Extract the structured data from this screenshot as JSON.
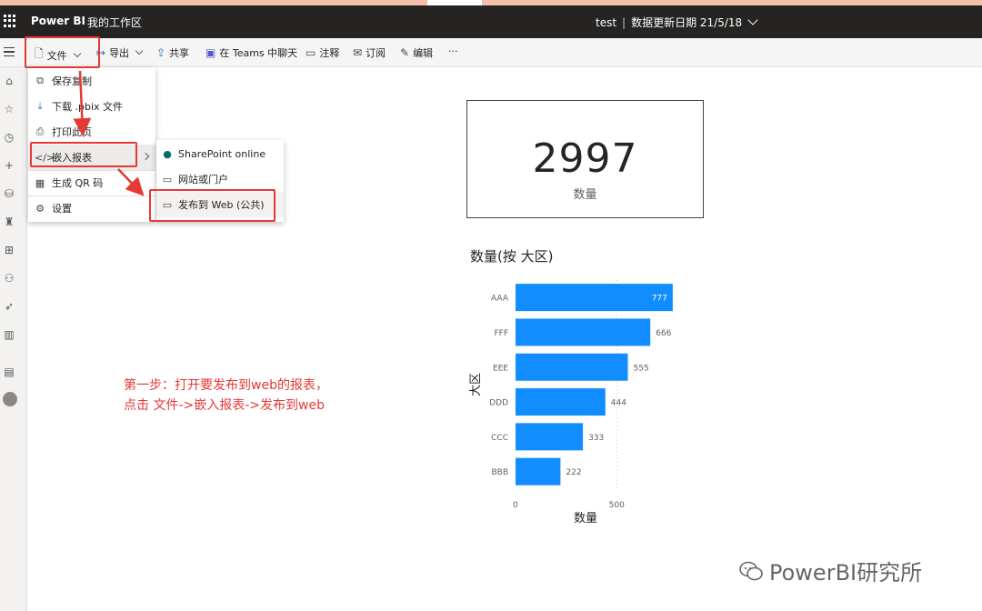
{
  "topbar": {
    "brand": "Power BI",
    "workspace": "我的工作区",
    "report_name": "test",
    "separator": "|",
    "data_updated": "数据更新日期 21/5/18"
  },
  "toolbar": {
    "file": "文件",
    "export": "导出",
    "share": "共享",
    "teams": "在 Teams 中聊天",
    "comment": "注释",
    "subscribe": "订阅",
    "edit": "编辑",
    "more": "···"
  },
  "file_menu": {
    "items": [
      {
        "label": "保存复制",
        "icon": "copy-icon"
      },
      {
        "label": "下载 .pbix 文件",
        "icon": "download-icon"
      },
      {
        "label": "打印此页",
        "icon": "print-icon"
      },
      {
        "label": "嵌入报表",
        "icon": "code-icon"
      },
      {
        "label": "生成 QR 码",
        "icon": "qr-icon"
      },
      {
        "label": "设置",
        "icon": "settings-icon"
      }
    ]
  },
  "embed_submenu": {
    "items": [
      {
        "label": "SharePoint online",
        "icon": "sharepoint-icon"
      },
      {
        "label": "网站或门户",
        "icon": "website-icon"
      },
      {
        "label": "发布到 Web (公共)",
        "icon": "publish-web-icon"
      }
    ]
  },
  "card": {
    "value": "2997",
    "label": "数量"
  },
  "chart_data": {
    "type": "bar",
    "orientation": "horizontal",
    "title": "数量(按 大区)",
    "xlabel": "数量",
    "ylabel": "大区",
    "categories": [
      "AAA",
      "FFF",
      "EEE",
      "DDD",
      "CCC",
      "BBB"
    ],
    "values": [
      777,
      666,
      555,
      444,
      333,
      222
    ],
    "xlim": [
      0,
      800
    ],
    "xticks": [
      0,
      500
    ],
    "bar_color": "#118dff",
    "gridlines": true
  },
  "annotation": {
    "line1": "第一步：打开要发布到web的报表，",
    "line2": "点击 文件->嵌入报表->发布到web"
  },
  "watermark": {
    "text": "PowerBI研究所"
  },
  "colors": {
    "highlight": "#e53935",
    "topbar": "#252423"
  }
}
